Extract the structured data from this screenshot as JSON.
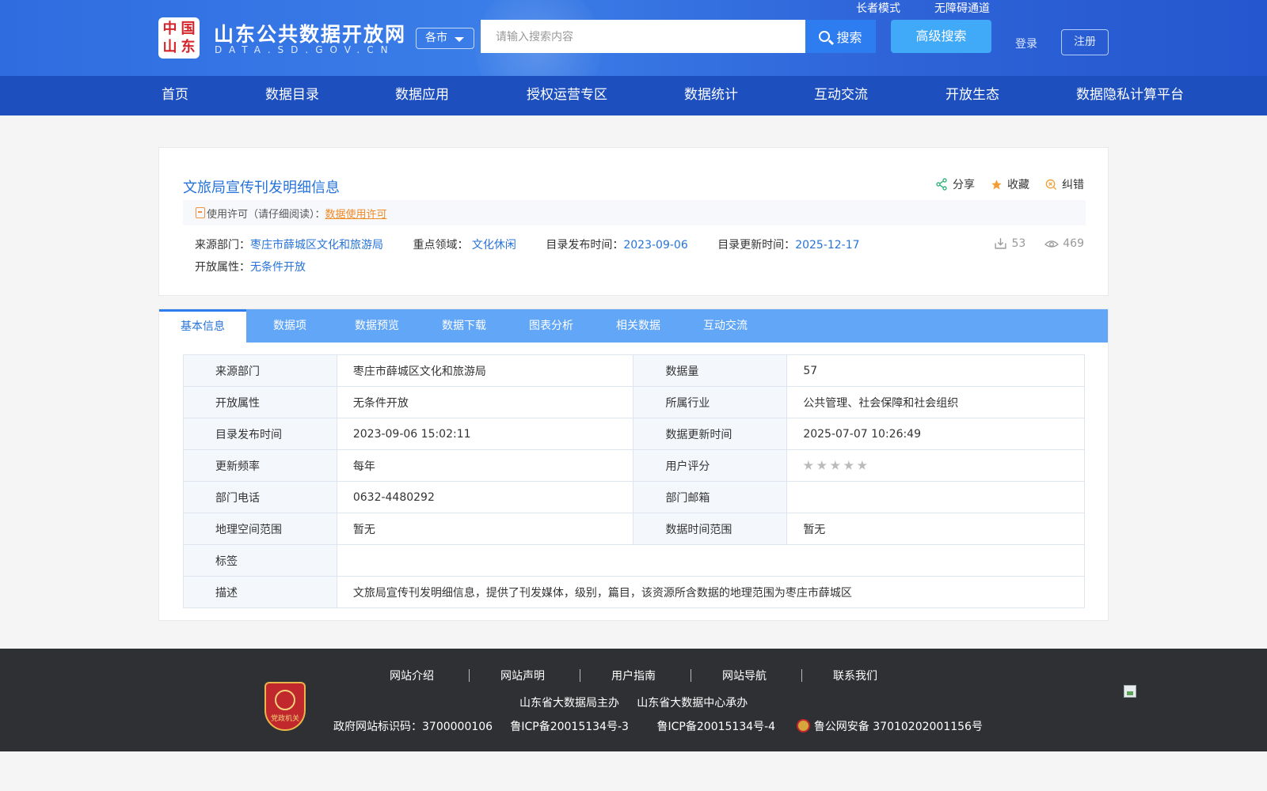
{
  "header": {
    "logo_chars": [
      "中",
      "国",
      "山",
      "东"
    ],
    "site_title": "山东公共数据开放网",
    "site_subtitle": "DATA.SD.GOV.CN",
    "city_select": "各市",
    "search_placeholder": "请输入搜索内容",
    "search_label": "搜索",
    "advanced_search_label": "高级搜索",
    "elder_mode": "长者模式",
    "accessibility": "无障碍通道",
    "login": "登录",
    "register": "注册"
  },
  "nav": [
    "首页",
    "数据目录",
    "数据应用",
    "授权运营专区",
    "数据统计",
    "互动交流",
    "开放生态",
    "数据隐私计算平台"
  ],
  "detail": {
    "title": "文旅局宣传刊发明细信息",
    "actions": {
      "share": "分享",
      "favorite": "收藏",
      "report": "纠错"
    },
    "license_prefix": "使用许可（请仔细阅读）：",
    "license_link": "数据使用许可",
    "source_label": "来源部门：",
    "source_value": "枣庄市薛城区文化和旅游局",
    "field_label": "重点领域：",
    "field_value": "文化休闲",
    "publish_label": "目录发布时间：",
    "publish_value": "2023-09-06",
    "update_label": "目录更新时间：",
    "update_value": "2025-12-17",
    "open_label": "开放属性：",
    "open_value": "无条件开放",
    "downloads": "53",
    "views": "469"
  },
  "tabs": [
    "基本信息",
    "数据项",
    "数据预览",
    "数据下载",
    "图表分析",
    "相关数据",
    "互动交流"
  ],
  "info_table": [
    [
      "来源部门",
      "枣庄市薛城区文化和旅游局",
      "数据量",
      "57"
    ],
    [
      "开放属性",
      "无条件开放",
      "所属行业",
      "公共管理、社会保障和社会组织"
    ],
    [
      "目录发布时间",
      "2023-09-06 15:02:11",
      "数据更新时间",
      "2025-07-07 10:26:49"
    ],
    [
      "更新频率",
      "每年",
      "用户评分",
      ""
    ],
    [
      "部门电话",
      "0632-4480292",
      "部门邮箱",
      ""
    ],
    [
      "地理空间范围",
      "暂无",
      "数据时间范围",
      "暂无"
    ],
    [
      "标签",
      ""
    ],
    [
      "描述",
      "文旅局宣传刊发明细信息，提供了刊发媒体，级别，篇目，该资源所含数据的地理范围为枣庄市薛城区"
    ]
  ],
  "rating_stars": 5,
  "footer": {
    "badge_text": "党政机关",
    "links": [
      "网站介绍",
      "网站声明",
      "用户指南",
      "网站导航",
      "联系我们"
    ],
    "host": "山东省大数据局主办",
    "organizer": "山东省大数据中心承办",
    "gov_id": "政府网站标识码：3700000106",
    "icp3": "鲁ICP备20015134号-3",
    "icp4": "鲁ICP备20015134号-4",
    "police": "鲁公网安备 37010202001156号"
  },
  "colors": {
    "header_blue": "#2f6ce0",
    "nav_blue": "#1d4fbf",
    "tab_blue": "#62a6f8",
    "link_blue": "#2673d9",
    "orange": "#f08a24"
  }
}
